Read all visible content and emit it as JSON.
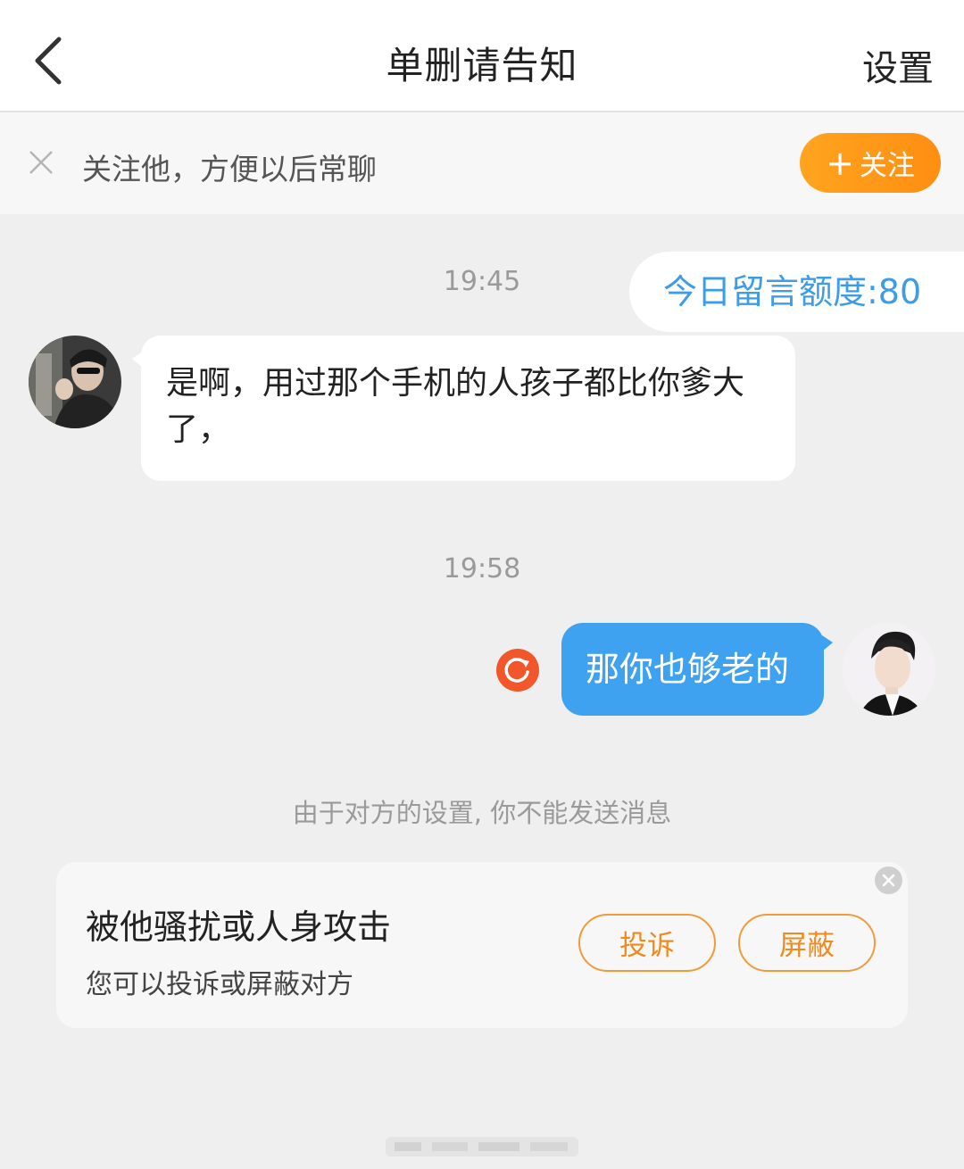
{
  "header": {
    "title": "单删请告知",
    "settings_label": "设置",
    "back_icon": "chevron-left-icon"
  },
  "follow_bar": {
    "text": "关注他，方便以后常聊",
    "button_plus": "+",
    "button_label": "关注",
    "accent": "#ff9a16"
  },
  "quota": {
    "text": "今日留言额度:80",
    "color": "#3d9ce8"
  },
  "messages": [
    {
      "time": "19:45",
      "direction": "incoming",
      "text": "是啊，用过那个手机的人孩子都比你爹大了，"
    },
    {
      "time": "19:58",
      "direction": "outgoing",
      "text": "那你也够老的",
      "status": "failed-resend",
      "bubble_color": "#3ea2f1"
    }
  ],
  "notice": "由于对方的设置, 你不能发送消息",
  "report_card": {
    "title": "被他骚扰或人身攻击",
    "subtitle": "您可以投诉或屏蔽对方",
    "complain_label": "投诉",
    "block_label": "屏蔽"
  }
}
